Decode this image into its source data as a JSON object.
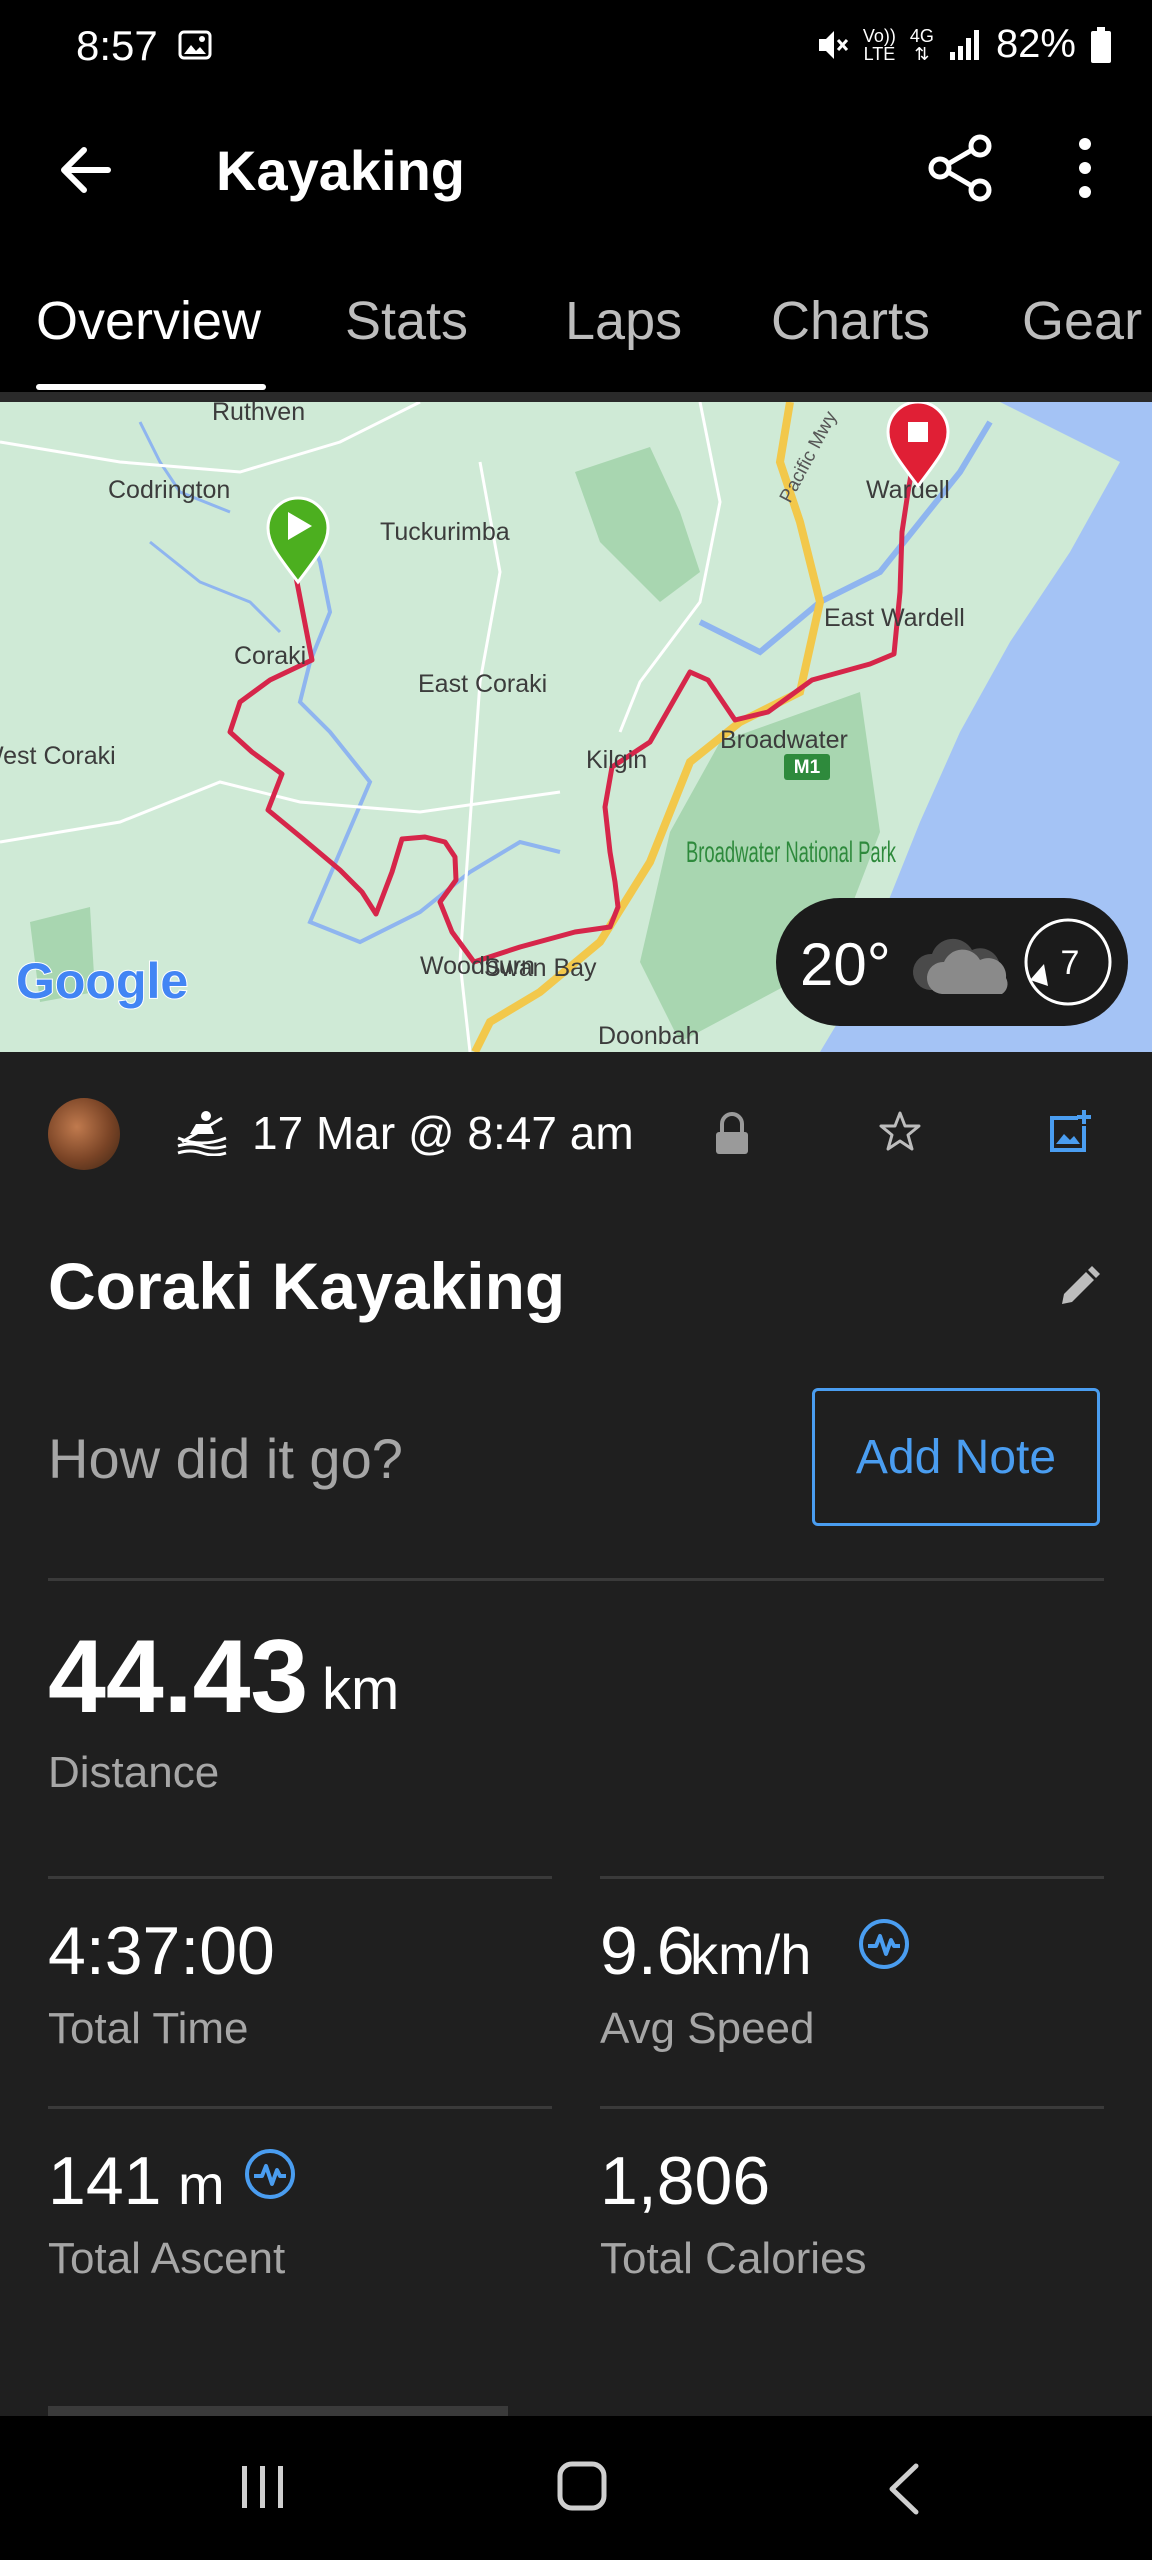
{
  "status_bar": {
    "time": "8:57",
    "volte": "Vo))",
    "lte": "LTE",
    "network": "4G",
    "battery": "82%",
    "icons": [
      "gallery-icon",
      "mute-icon",
      "signal-icon",
      "battery-icon"
    ]
  },
  "app_bar": {
    "title": "Kayaking",
    "icons": [
      "back-arrow-icon",
      "share-icon",
      "more-vert-icon"
    ]
  },
  "tabs": [
    "Overview",
    "Stats",
    "Laps",
    "Charts",
    "Gear"
  ],
  "active_tab": "Overview",
  "map": {
    "place_labels": [
      "Ruthven",
      "Codrington",
      "Tuckurimba",
      "Wardell",
      "Pacific Mwy",
      "East Wardell",
      "Coraki",
      "East Coraki",
      "West Coraki",
      "Kilgin",
      "Broadwater",
      "M1",
      "Broadwater National Park",
      "Woodburn",
      "Swan Bay",
      "Doonbah"
    ],
    "provider": "Google",
    "route_color": "#d6264a",
    "start_marker_color": "#4caf1f",
    "end_marker_color": "#e01f35",
    "water_color": "#a4c3f5",
    "land_color": "#cfead6"
  },
  "weather": {
    "temperature": "20°",
    "condition_icon": "cloud-icon",
    "wind_speed": "7"
  },
  "activity": {
    "date": "17 Mar @ 8:47 am",
    "title": "Coraki Kayaking",
    "note_prompt": "How did it go?",
    "add_note_label": "Add Note",
    "icons": [
      "avatar",
      "kayak-icon",
      "lock-icon",
      "star-icon",
      "add-photo-icon",
      "edit-pencil-icon"
    ]
  },
  "stats": {
    "distance": {
      "value": "44.43",
      "unit": "km",
      "label": "Distance"
    },
    "total_time": {
      "value": "4:37:00",
      "label": "Total Time"
    },
    "avg_speed": {
      "value": "9.6",
      "unit": "km/h",
      "label": "Avg Speed"
    },
    "total_ascent": {
      "value": "141",
      "unit": "m",
      "label": "Total Ascent"
    },
    "total_calories": {
      "value": "1,806",
      "label": "Total Calories"
    }
  },
  "accent_color": "#4a9df0",
  "nav_bar": {
    "icons": [
      "recents-icon",
      "home-icon",
      "back-icon"
    ]
  }
}
